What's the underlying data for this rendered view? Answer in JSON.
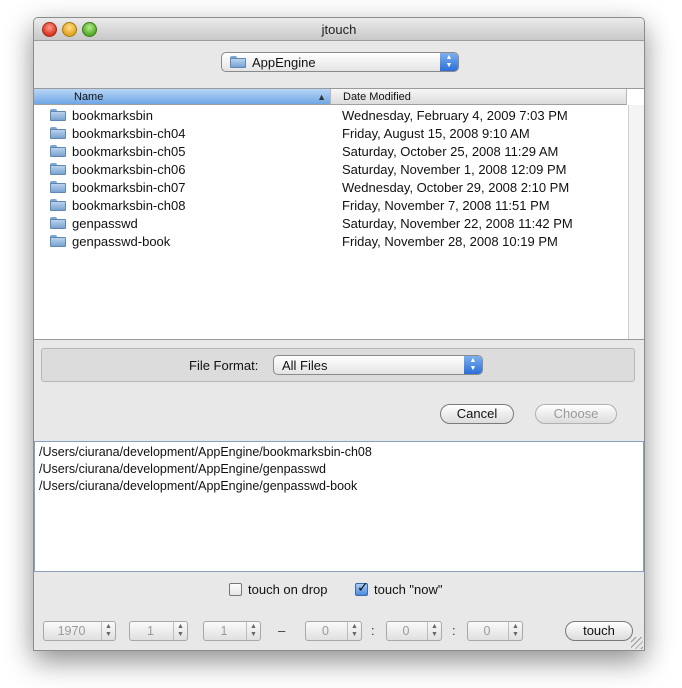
{
  "window": {
    "title": "jtouch"
  },
  "location": {
    "selected": "AppEngine"
  },
  "columns": {
    "name": "Name",
    "date": "Date Modified"
  },
  "files": [
    {
      "name": "bookmarksbin",
      "date": "Wednesday, February 4, 2009 7:03 PM"
    },
    {
      "name": "bookmarksbin-ch04",
      "date": "Friday, August 15, 2008 9:10 AM"
    },
    {
      "name": "bookmarksbin-ch05",
      "date": "Saturday, October 25, 2008 11:29 AM"
    },
    {
      "name": "bookmarksbin-ch06",
      "date": "Saturday, November 1, 2008 12:09 PM"
    },
    {
      "name": "bookmarksbin-ch07",
      "date": "Wednesday, October 29, 2008 2:10 PM"
    },
    {
      "name": "bookmarksbin-ch08",
      "date": "Friday, November 7, 2008 11:51 PM"
    },
    {
      "name": "genpasswd",
      "date": "Saturday, November 22, 2008 11:42 PM"
    },
    {
      "name": "genpasswd-book",
      "date": "Friday, November 28, 2008 10:19 PM"
    }
  ],
  "file_format": {
    "label": "File Format:",
    "selected": "All Files"
  },
  "buttons": {
    "cancel": "Cancel",
    "choose": "Choose",
    "touch": "touch"
  },
  "paths": [
    "/Users/ciurana/development/AppEngine/bookmarksbin-ch08",
    "/Users/ciurana/development/AppEngine/genpasswd",
    "/Users/ciurana/development/AppEngine/genpasswd-book"
  ],
  "options": {
    "touch_on_drop": "touch on drop",
    "touch_now": "touch \"now\"",
    "touch_on_drop_checked": false,
    "touch_now_checked": true
  },
  "datetime": {
    "year": "1970",
    "month": "1",
    "day": "1",
    "dash": "–",
    "hour": "0",
    "minute": "0",
    "second": "0",
    "colon": ":"
  },
  "icons": {
    "close": "close-button-icon",
    "minimize": "minimize-button-icon",
    "zoom": "zoom-button-icon",
    "folder": "folder-icon",
    "check": "checkmark-icon"
  },
  "colors": {
    "selection": "#6fa6e6",
    "window": "#e8e8e8"
  }
}
